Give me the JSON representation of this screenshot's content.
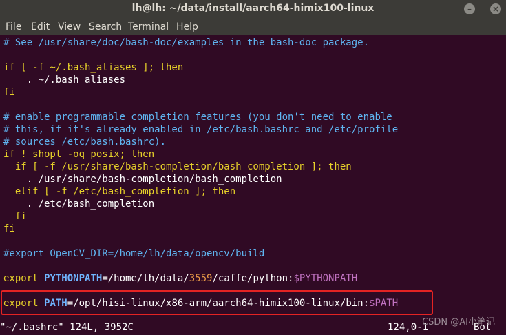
{
  "window": {
    "title": "lh@lh: ~/data/install/aarch64-himix100-linux",
    "min_btn": "–",
    "close_btn": "×"
  },
  "menu": [
    "File",
    "Edit",
    "View",
    "Search",
    "Terminal",
    "Help"
  ],
  "lines": [
    {
      "parts": [
        {
          "text": "# See /usr/share/doc/bash-doc/examples in the bash-doc package.",
          "cls": "c"
        }
      ]
    },
    {
      "parts": []
    },
    {
      "parts": [
        {
          "text": "if [ -f ~/.bash_aliases ]; ",
          "cls": "k"
        },
        {
          "text": "then",
          "cls": "k"
        }
      ]
    },
    {
      "parts": [
        {
          "text": "    . ~/.bash_aliases",
          "cls": ""
        }
      ]
    },
    {
      "parts": [
        {
          "text": "fi",
          "cls": "k"
        }
      ]
    },
    {
      "parts": []
    },
    {
      "parts": [
        {
          "text": "# enable programmable completion features (you don't need to enable",
          "cls": "c"
        }
      ]
    },
    {
      "parts": [
        {
          "text": "# this, if it's already enabled in /etc/bash.bashrc and /etc/profile",
          "cls": "c"
        }
      ]
    },
    {
      "parts": [
        {
          "text": "# sources /etc/bash.bashrc).",
          "cls": "c"
        }
      ]
    },
    {
      "parts": [
        {
          "text": "if ! shopt -oq posix; ",
          "cls": "k"
        },
        {
          "text": "then",
          "cls": "k"
        }
      ]
    },
    {
      "parts": [
        {
          "text": "  if [ -f /usr/share/bash-completion/bash_completion ]; ",
          "cls": "k"
        },
        {
          "text": "then",
          "cls": "k"
        }
      ]
    },
    {
      "parts": [
        {
          "text": "    . /usr/share/bash-completion/bash_completion",
          "cls": ""
        }
      ]
    },
    {
      "parts": [
        {
          "text": "  elif [ -f /etc/bash_completion ]; ",
          "cls": "k"
        },
        {
          "text": "then",
          "cls": "k"
        }
      ]
    },
    {
      "parts": [
        {
          "text": "    . /etc/bash_completion",
          "cls": ""
        }
      ]
    },
    {
      "parts": [
        {
          "text": "  fi",
          "cls": "k"
        }
      ]
    },
    {
      "parts": [
        {
          "text": "fi",
          "cls": "k"
        }
      ]
    },
    {
      "parts": []
    },
    {
      "parts": [
        {
          "text": "#export OpenCV_DIR=/home/lh/data/opencv/build",
          "cls": "c"
        }
      ]
    },
    {
      "parts": []
    },
    {
      "parts": [
        {
          "text": "export ",
          "cls": "k"
        },
        {
          "text": "PYTHONPATH",
          "cls": "v"
        },
        {
          "text": "=/home/lh/data/",
          "cls": ""
        },
        {
          "text": "3559",
          "cls": "n"
        },
        {
          "text": "/caffe/python:",
          "cls": ""
        },
        {
          "text": "$PYTHONPATH",
          "cls": "p"
        }
      ]
    },
    {
      "parts": []
    },
    {
      "parts": [
        {
          "text": "export ",
          "cls": "k"
        },
        {
          "text": "PATH",
          "cls": "v"
        },
        {
          "text": "=/opt/hisi-linux/x86-arm/aarch64-himix100-linux/bin:",
          "cls": ""
        },
        {
          "text": "$PATH",
          "cls": "p"
        }
      ]
    }
  ],
  "status": {
    "file": "\"~/.bashrc\" 124L, 3952C",
    "pos": "124,0-1",
    "scroll": "Bot"
  },
  "watermark": "CSDN @AI小笔记",
  "colors": {
    "bg": "#300a24",
    "highlight_box": "#e42323"
  }
}
